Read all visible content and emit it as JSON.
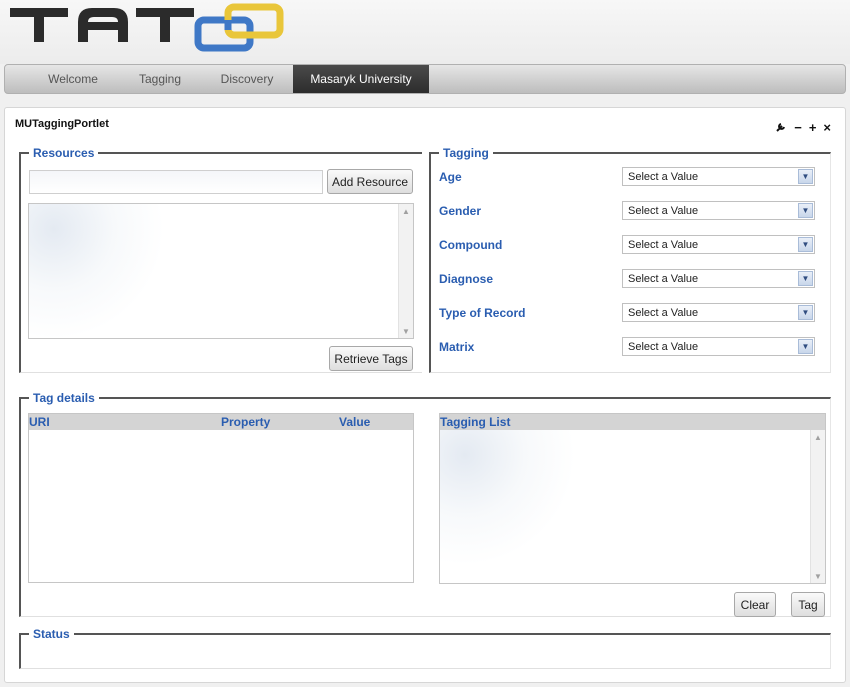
{
  "logo": {
    "text": "TATOO",
    "colors": {
      "dark": "#2b2b2b",
      "blue": "#3f78c6",
      "yellow": "#e9c63a"
    }
  },
  "nav": {
    "tabs": [
      {
        "label": "Welcome",
        "active": false
      },
      {
        "label": "Tagging",
        "active": false
      },
      {
        "label": "Discovery",
        "active": false
      },
      {
        "label": "Masaryk University",
        "active": true
      }
    ]
  },
  "portlet": {
    "title": "MUTaggingPortlet",
    "icons": [
      "wrench-icon",
      "minimize-icon",
      "maximize-icon",
      "close-icon"
    ]
  },
  "resources": {
    "legend": "Resources",
    "input_value": "",
    "add_button": "Add Resource",
    "retrieve_button": "Retrieve Tags"
  },
  "tagging": {
    "legend": "Tagging",
    "fields": [
      {
        "label": "Age",
        "value": "Select a Value"
      },
      {
        "label": "Gender",
        "value": "Select a Value"
      },
      {
        "label": "Compound",
        "value": "Select a Value"
      },
      {
        "label": "Diagnose",
        "value": "Select a Value"
      },
      {
        "label": "Type of Record",
        "value": "Select a Value"
      },
      {
        "label": "Matrix",
        "value": "Select a Value"
      }
    ]
  },
  "tag_details": {
    "legend": "Tag details",
    "columns": [
      "URI",
      "Property",
      "Value"
    ],
    "tagging_list_header": "Tagging List",
    "clear_button": "Clear",
    "tag_button": "Tag"
  },
  "status": {
    "legend": "Status",
    "text": ""
  },
  "colors": {
    "accent": "#2a5db0",
    "active_tab": "#333333"
  }
}
